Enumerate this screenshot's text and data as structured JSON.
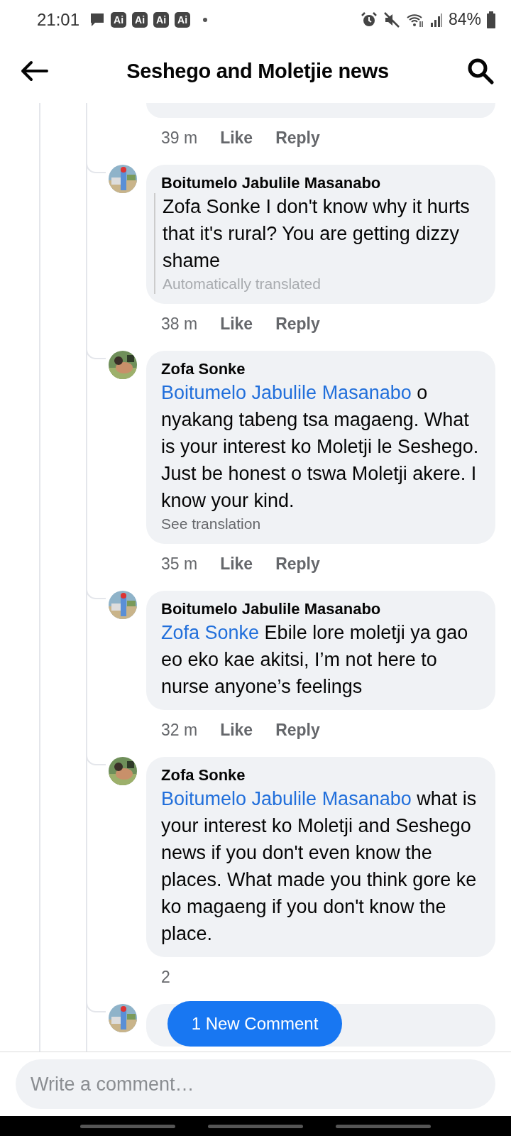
{
  "status_bar": {
    "time": "21:01",
    "notifications": [
      "Ai",
      "Ai",
      "Ai",
      "Ai"
    ],
    "battery": "84%"
  },
  "header": {
    "title": "Seshego and Moletjie news"
  },
  "comments": [
    {
      "kind": "partial",
      "time": "39 m",
      "actions": [
        "Like",
        "Reply"
      ]
    },
    {
      "kind": "reply",
      "author": "Boitumelo Jabulile Masanabo",
      "text": "Zofa Sonke I don't know why it hurts that it's rural? You are getting dizzy shame",
      "translated": true,
      "note": "Automatically translated",
      "time": "38 m",
      "actions": [
        "Like",
        "Reply"
      ]
    },
    {
      "kind": "reply",
      "author": "Zofa Sonke",
      "mention": "Boitumelo Jabulile Masanabo",
      "text": "o nyakang tabeng tsa magaeng. What is your interest ko Moletji le Seshego. Just be honest o tswa Moletji akere. I know your kind.",
      "translated": false,
      "note": "See translation",
      "time": "35 m",
      "actions": [
        "Like",
        "Reply"
      ]
    },
    {
      "kind": "reply",
      "author": "Boitumelo Jabulile Masanabo",
      "mention": "Zofa Sonke",
      "text": "Ebile lore moletji ya gao eo eko kae akitsi, I’m not here to nurse anyone’s feelings",
      "translated": false,
      "time": "32 m",
      "actions": [
        "Like",
        "Reply"
      ]
    },
    {
      "kind": "reply",
      "author": "Zofa Sonke",
      "mention": "Boitumelo Jabulile Masanabo",
      "text": "what is your interest ko Moletji and Seshego news if you don't even know the places. What made you think gore ke ko magaeng if you don't know the place.",
      "translated": false,
      "time": "2"
    },
    {
      "kind": "cut"
    }
  ],
  "new_comments": {
    "label": "1 New Comment"
  },
  "composer": {
    "placeholder": "Write a comment…"
  }
}
